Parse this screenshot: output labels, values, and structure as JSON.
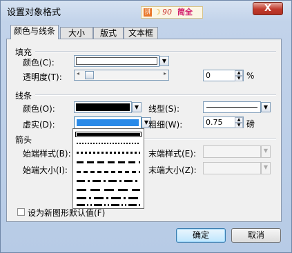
{
  "window": {
    "title": "设置对象格式",
    "close_label": "X"
  },
  "ime": {
    "logo": "拼",
    "moon": "☽",
    "brand": "90",
    "mode": "简全"
  },
  "tabs": [
    {
      "label": "颜色与线条"
    },
    {
      "label": "大小"
    },
    {
      "label": "版式"
    },
    {
      "label": "文本框"
    }
  ],
  "fill": {
    "section": "填充",
    "color_label": "颜色(C):",
    "color_value": "#ffffff",
    "transparency_label": "透明度(T):",
    "transparency_value": "0",
    "transparency_unit": "%"
  },
  "line": {
    "section": "线条",
    "color_label": "颜色(O):",
    "color_value": "#000000",
    "linetype_label": "线型(S):",
    "dash_label": "虚实(D):",
    "dash_value_color": "#2a8ae8",
    "weight_label": "粗细(W):",
    "weight_value": "0.75",
    "weight_unit": "磅"
  },
  "arrows": {
    "section": "箭头",
    "begin_style_label": "始端样式(B):",
    "end_style_label": "末端样式(E):",
    "begin_size_label": "始端大小(I):",
    "end_size_label": "末端大小(Z):"
  },
  "dash_options": [
    "实线",
    "圆点",
    "方点",
    "短划线",
    "划线",
    "划线-点",
    "长划线",
    "长划线-点",
    "长划线-点-点"
  ],
  "default_checkbox_label": "设为新图形默认值(F)",
  "buttons": {
    "ok": "确定",
    "cancel": "取消"
  }
}
